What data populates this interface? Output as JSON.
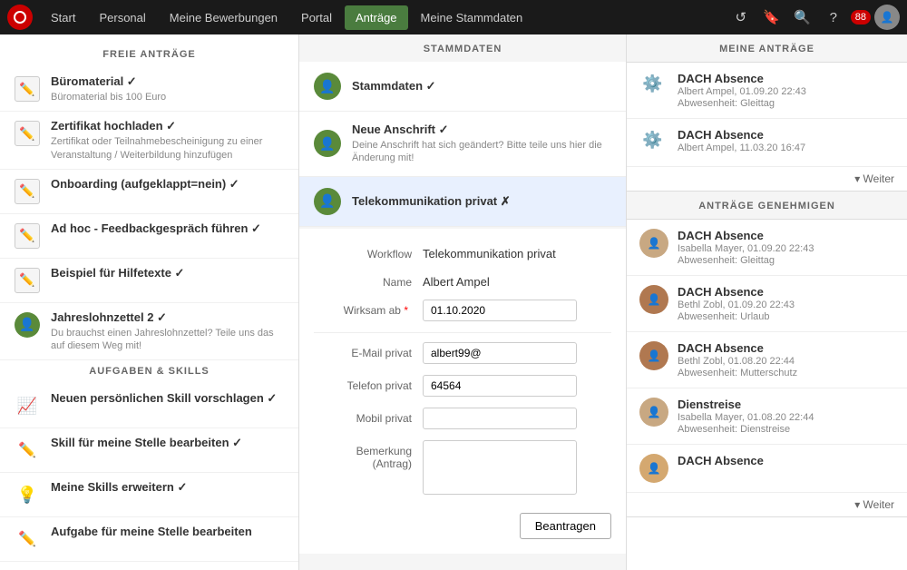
{
  "nav": {
    "items": [
      {
        "label": "Start",
        "active": false
      },
      {
        "label": "Personal",
        "active": false
      },
      {
        "label": "Meine Bewerbungen",
        "active": false
      },
      {
        "label": "Portal",
        "active": false
      },
      {
        "label": "Anträge",
        "active": true
      },
      {
        "label": "Meine Stammdaten",
        "active": false
      }
    ],
    "badge": "88"
  },
  "left": {
    "freie_antraege_header": "FREIE ANTRÄGE",
    "items": [
      {
        "title": "Büromaterial ✓",
        "subtitle": "Büromaterial bis 100 Euro",
        "icon": "edit"
      },
      {
        "title": "Zertifikat hochladen ✓",
        "subtitle": "Zertifikat oder Teilnahmebescheinigung zu einer Veranstaltung / Weiterbildung hinzufügen",
        "icon": "edit"
      },
      {
        "title": "Onboarding (aufgeklappt=nein) ✓",
        "subtitle": "",
        "icon": "edit"
      },
      {
        "title": "Ad hoc - Feedbackgespräch führen ✓",
        "subtitle": "",
        "icon": "edit"
      },
      {
        "title": "Beispiel für Hilfetexte ✓",
        "subtitle": "",
        "icon": "edit"
      },
      {
        "title": "Jahreslohnzettel 2 ✓",
        "subtitle": "Du brauchst einen Jahreslohnzettel? Teile uns das auf diesem Weg mit!",
        "icon": "person"
      }
    ],
    "aufgaben_header": "AUFGABEN & SKILLS",
    "skill_items": [
      {
        "title": "Neuen persönlichen Skill vorschlagen ✓",
        "subtitle": "",
        "icon": "chart"
      },
      {
        "title": "Skill für meine Stelle bearbeiten ✓",
        "subtitle": "",
        "icon": "pencil"
      },
      {
        "title": "Meine Skills erweitern ✓",
        "subtitle": "",
        "icon": "bulb"
      },
      {
        "title": "Aufgabe für meine Stelle bearbeiten",
        "subtitle": "",
        "icon": "pencil"
      }
    ]
  },
  "middle": {
    "header": "STAMMDATEN",
    "stammdaten_items": [
      {
        "title": "Stammdaten ✓",
        "subtitle": "",
        "icon": "person"
      },
      {
        "title": "Neue Anschrift ✓",
        "subtitle": "Deine Anschrift hat sich geändert? Bitte teile uns hier die Änderung mit!",
        "icon": "person"
      },
      {
        "title": "Telekommunikation privat ✗",
        "subtitle": "",
        "icon": "person",
        "active": true
      }
    ],
    "form": {
      "workflow_label": "Workflow",
      "workflow_value": "Telekommunikation privat",
      "name_label": "Name",
      "name_value": "Albert Ampel",
      "wirksam_label": "Wirksam ab",
      "wirksam_value": "01.10.2020",
      "email_label": "E-Mail privat",
      "email_value": "albert99@",
      "telefon_label": "Telefon privat",
      "telefon_value": "64564",
      "mobil_label": "Mobil privat",
      "mobil_value": "",
      "bemerkung_label": "Bemerkung (Antrag)",
      "bemerkung_value": "",
      "btn_label": "Beantragen"
    }
  },
  "right": {
    "meine_header": "MEINE ANTRÄGE",
    "meine_items": [
      {
        "title": "DACH Absence",
        "sub1": "Albert Ampel, 01.09.20 22:43",
        "sub2": "Abwesenheit: Gleittag"
      },
      {
        "title": "DACH Absence",
        "sub1": "Albert Ampel, 11.03.20 16:47",
        "sub2": ""
      }
    ],
    "weiter_label": "▾ Weiter",
    "genehmigen_header": "ANTRÄGE GENEHMIGEN",
    "genehmigen_items": [
      {
        "title": "DACH Absence",
        "sub1": "Isabella Mayer, 01.09.20 22:43",
        "sub2": "Abwesenheit: Gleittag",
        "avatar": "1"
      },
      {
        "title": "DACH Absence",
        "sub1": "Bethl Zobl, 01.09.20 22:43",
        "sub2": "Abwesenheit: Urlaub",
        "avatar": "2"
      },
      {
        "title": "DACH Absence",
        "sub1": "Bethl Zobl, 01.08.20 22:44",
        "sub2": "Abwesenheit: Mutterschutz",
        "avatar": "2"
      },
      {
        "title": "Dienstreise",
        "sub1": "Isabella Mayer, 01.08.20 22:44",
        "sub2": "Abwesenheit: Dienstreise",
        "avatar": "1"
      },
      {
        "title": "DACH Absence",
        "sub1": "",
        "sub2": "",
        "avatar": "3"
      }
    ],
    "weiter2_label": "▾ Weiter"
  }
}
